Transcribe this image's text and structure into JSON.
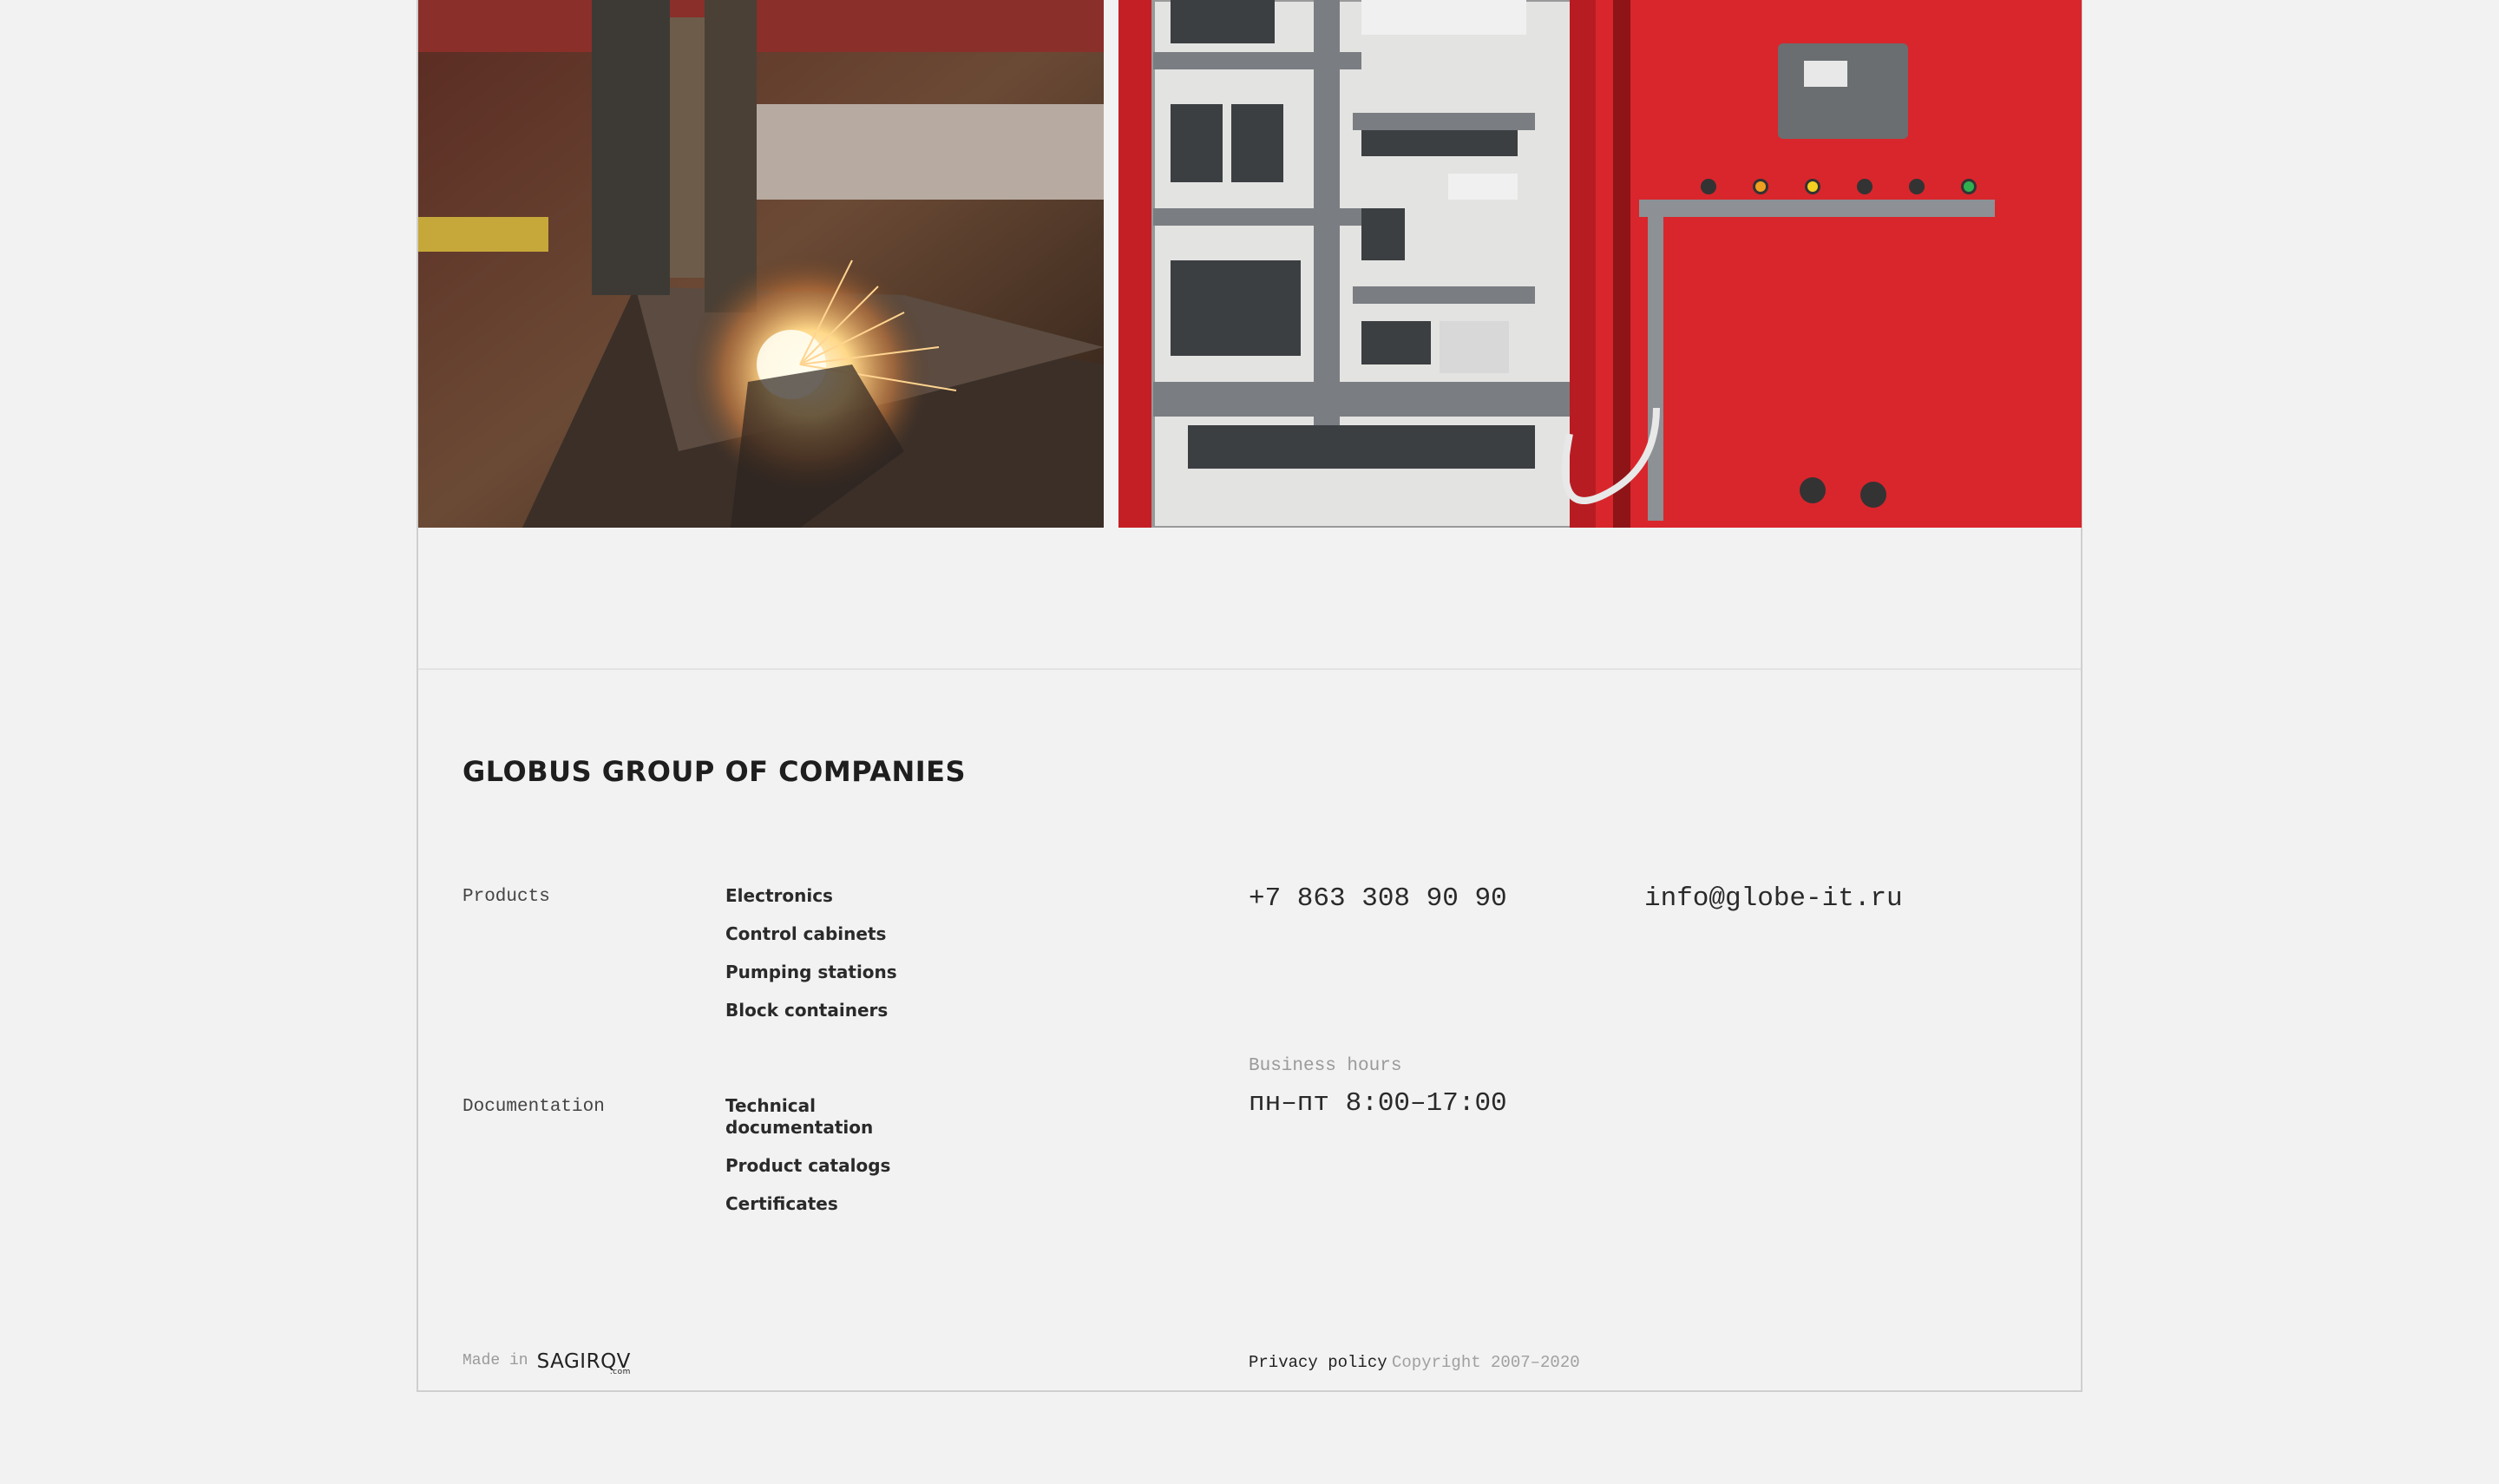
{
  "company": {
    "name": "GLOBUS GROUP OF COMPANIES"
  },
  "sections": [
    {
      "label": "Products",
      "links": [
        "Electronics",
        "Control cabinets",
        "Pumping stations",
        "Block containers"
      ]
    },
    {
      "label": "Documentation",
      "links": [
        "Technical documentation",
        "Product catalogs",
        "Certificates"
      ]
    }
  ],
  "contacts": {
    "phone": "+7 863 308 90 90",
    "email": "info@globe-it.ru",
    "hours_label": "Business hours",
    "hours": "пн–пт 8:00–17:00"
  },
  "footer": {
    "made_in": "Made in",
    "logo_text": "SAGIRQV",
    "logo_sub": ".com",
    "privacy": "Privacy policy",
    "copyright": "Copyright 2007–2020"
  },
  "images": {
    "left": "plasma-cutting-photo",
    "right": "control-cabinet-photo"
  },
  "colors": {
    "background": "#f2f2f2",
    "text": "#222222",
    "muted": "#9a9a9a",
    "cabinet_red": "#d8262c"
  }
}
